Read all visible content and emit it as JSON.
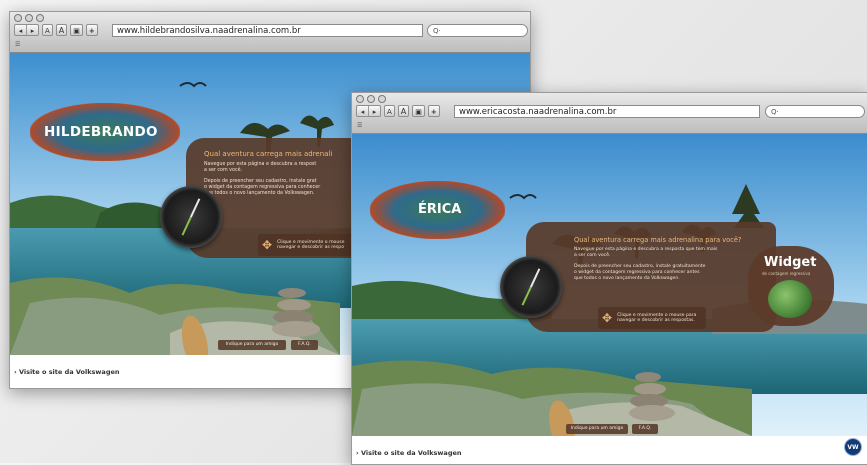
{
  "window_back": {
    "url": "www.hildebrandosilva.naadrenalina.com.br",
    "search_placeholder": "Q",
    "bookmark": "☰",
    "name_banner": "HILDEBRANDO",
    "panel_title": "Qual aventura carrega mais adrenali",
    "panel_text_1": "Navegue por esta página e descubra a respost",
    "panel_text_1b": "a ser com você.",
    "panel_text_2": "Depois de preencher seu cadastro, instale grat",
    "panel_text_2b": "o widget da contagem regressiva para conhecer",
    "panel_text_2c": "que todos o novo lançamento da Volkswagen.",
    "hint": "Clique e movimente o mouse",
    "hint_b": "navegar e descobrir as respo",
    "btn_indique": "Indique para um amigo",
    "btn_faq": "F.A.Q.",
    "footer_link": "› Visite o site da Volkswagen"
  },
  "window_front": {
    "url": "www.ericacosta.naadrenalina.com.br",
    "search_placeholder": "Q",
    "bookmark": "☰",
    "name_banner": "ÉRICA",
    "panel_title": "Qual aventura carrega mais adrenalina para você?",
    "panel_text_1": "Navegue por esta página e descubra a resposta que tem mais",
    "panel_text_1b": "a ser com você.",
    "panel_text_2": "Depois de preencher seu cadastro, instale gratuitamente",
    "panel_text_2b": "o widget da contagem regressiva para conhecer antes",
    "panel_text_2c": "que todos o novo lançamento da Volkswagen.",
    "hint": "Clique e movimente o mouse para",
    "hint_b": "navegar e descobrir as respostas.",
    "widget_title": "Widget",
    "widget_sub": "de contagem regressiva",
    "btn_indique": "Indique para um amigo",
    "btn_faq": "F.A.Q.",
    "footer_link": "› Visite o site da Volkswagen",
    "vw_logo": "VW"
  },
  "toolbar": {
    "back": "◂",
    "forward": "▸",
    "font_small": "A",
    "font_large": "A",
    "camera": "▣",
    "add": "+"
  },
  "colors": {
    "panel": "#583a2a",
    "accent": "#ecb978",
    "sky_top": "#3f8fd0",
    "sea": "#2e7c8c"
  }
}
